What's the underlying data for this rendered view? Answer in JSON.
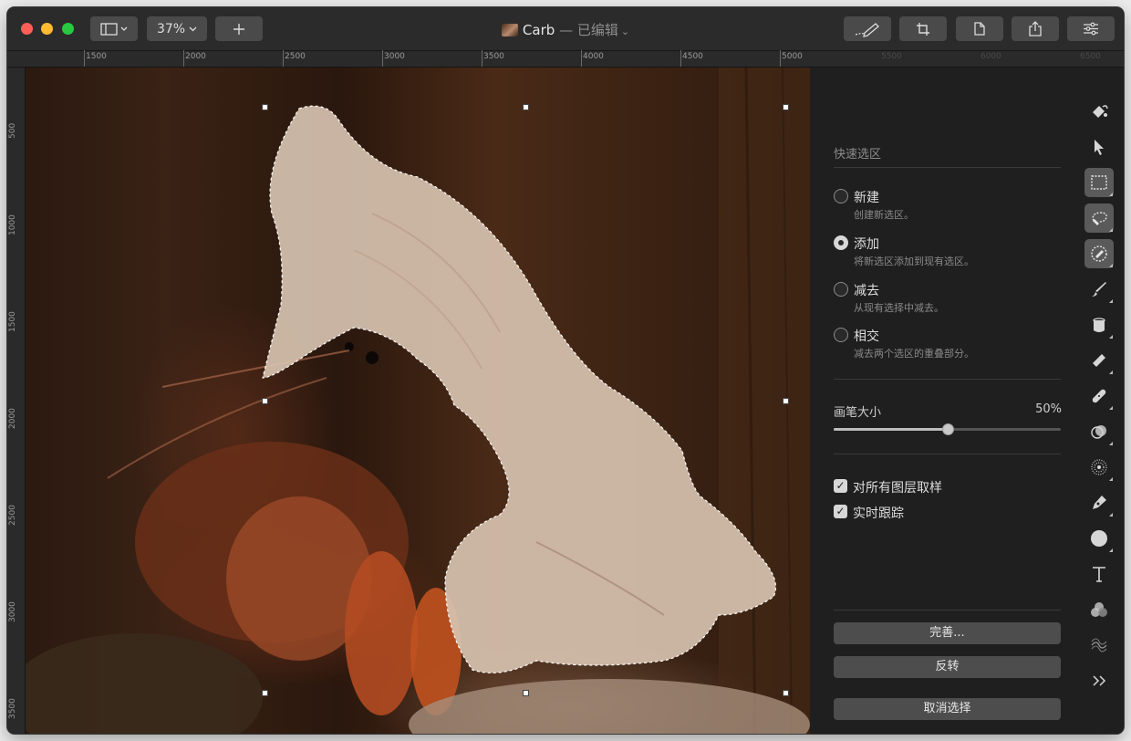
{
  "titlebar": {
    "zoom_label": "37%",
    "document_name": "Carb",
    "document_status": "— 已编辑",
    "caret": "⌄"
  },
  "ruler": {
    "horizontal_labels": [
      "1500",
      "2000",
      "2500",
      "3000",
      "3500",
      "4000",
      "4500",
      "5000",
      "5500",
      "6000",
      "6500"
    ],
    "vertical_labels": [
      "500",
      "1000",
      "1500",
      "2000",
      "2500",
      "3000",
      "3500"
    ]
  },
  "panel": {
    "title": "快速选区",
    "options": [
      {
        "label": "新建",
        "desc": "创建新选区。",
        "checked": false
      },
      {
        "label": "添加",
        "desc": "将新选区添加到现有选区。",
        "checked": true
      },
      {
        "label": "减去",
        "desc": "从现有选择中减去。",
        "checked": false
      },
      {
        "label": "相交",
        "desc": "减去两个选区的重叠部分。",
        "checked": false
      }
    ],
    "brush_size_label": "画笔大小",
    "brush_size_value": "50%",
    "brush_size_fraction": 0.5,
    "checkboxes": [
      {
        "label": "对所有图层取样",
        "checked": true
      },
      {
        "label": "实时跟踪",
        "checked": true
      }
    ],
    "buttons": {
      "refine": "完善...",
      "invert": "反转",
      "deselect": "取消选择"
    }
  },
  "tools": [
    {
      "name": "paint-bucket-icon"
    },
    {
      "name": "arrow-pointer-icon"
    },
    {
      "name": "rect-select-icon"
    },
    {
      "name": "magnetic-lasso-icon"
    },
    {
      "name": "quick-selection-icon"
    },
    {
      "name": "brush-icon"
    },
    {
      "name": "fill-bucket-icon"
    },
    {
      "name": "eraser-icon"
    },
    {
      "name": "bandage-icon"
    },
    {
      "name": "clone-icon"
    },
    {
      "name": "blur-icon"
    },
    {
      "name": "pen-icon"
    },
    {
      "name": "shape-icon"
    },
    {
      "name": "text-icon"
    },
    {
      "name": "color-adjust-icon"
    },
    {
      "name": "distort-icon"
    },
    {
      "name": "more-tools-icon"
    }
  ],
  "colors": {
    "window_bg": "#1e1e1e",
    "accent_button": "#4d4d4d",
    "active_tool": "#5a5a5a"
  }
}
